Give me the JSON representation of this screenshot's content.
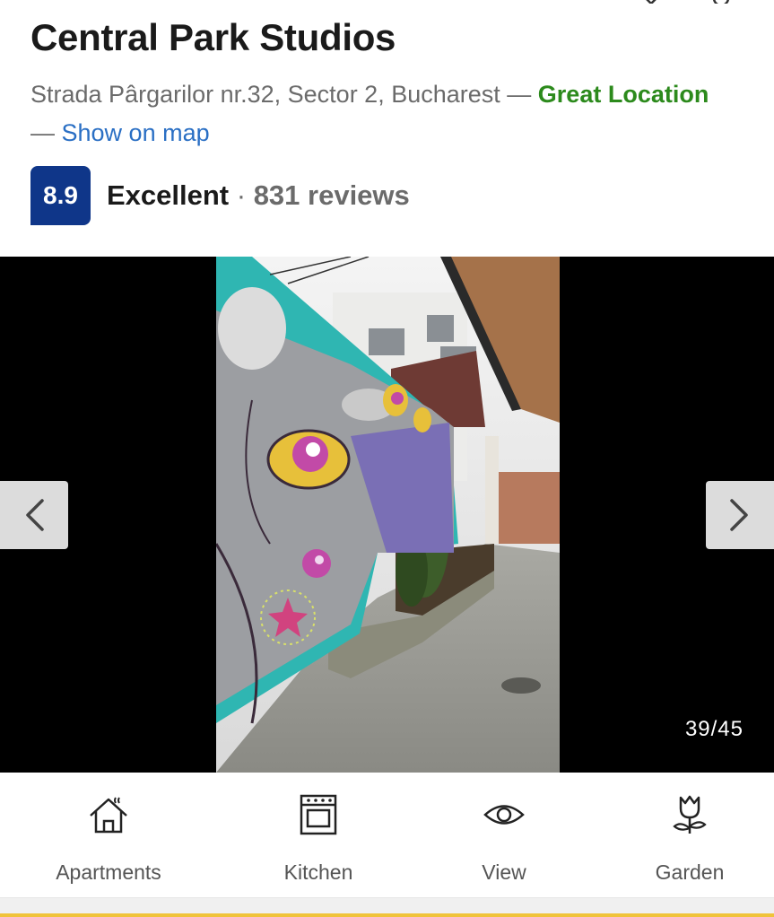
{
  "property": {
    "name": "Central Park Studios",
    "address": "Strada Pârgarilor nr.32, Sector 2, Bucharest",
    "separator": " — ",
    "location_badge": "Great Location",
    "map_link": "Show on map"
  },
  "rating": {
    "score": "8.9",
    "label": "Excellent",
    "dot": " · ",
    "reviews": "831 reviews"
  },
  "gallery": {
    "counter": "39/45",
    "prev_icon": "chevron-left-icon",
    "next_icon": "chevron-right-icon"
  },
  "facilities": [
    {
      "label": "Apartments",
      "icon": "house-icon"
    },
    {
      "label": "Kitchen",
      "icon": "oven-icon"
    },
    {
      "label": "View",
      "icon": "eye-icon"
    },
    {
      "label": "Garden",
      "icon": "tulip-icon"
    }
  ],
  "colors": {
    "score_badge": "#0f3689",
    "great_location": "#2c8a1c",
    "link": "#2a6fc4",
    "accent_line": "#f0c33a"
  }
}
